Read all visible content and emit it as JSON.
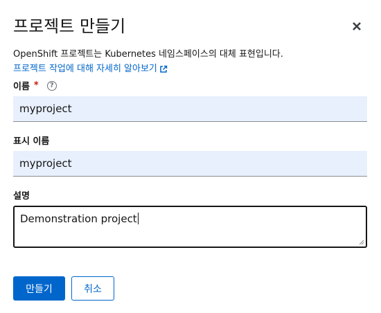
{
  "dialog": {
    "title": "프로젝트 만들기",
    "description": "OpenShift 프로젝트는 Kubernetes 네임스페이스의 대체 표현입니다.",
    "learn_more_link": "프로젝트 작업에 대해 자세히 알아보기"
  },
  "form": {
    "name": {
      "label": "이름",
      "required_mark": "*",
      "value": "myproject"
    },
    "display_name": {
      "label": "표시 이름",
      "value": "myproject"
    },
    "description": {
      "label": "설명",
      "value": "Demonstration project"
    }
  },
  "actions": {
    "create_label": "만들기",
    "cancel_label": "취소"
  },
  "colors": {
    "primary": "#0066cc",
    "required": "#c9190b",
    "autofill_bg": "#e8f0fe"
  }
}
